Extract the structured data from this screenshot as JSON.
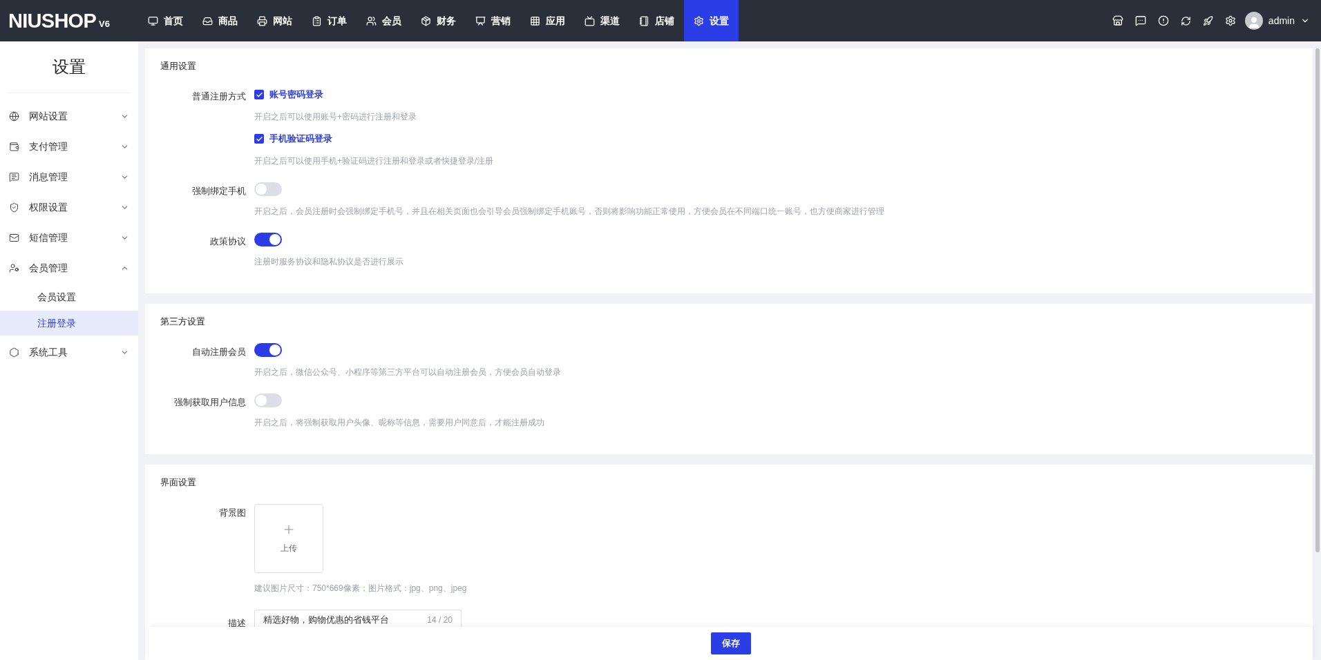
{
  "topbar": {
    "logo": "NIUSHOP",
    "version": "V6",
    "menu": [
      {
        "label": "首页",
        "selected": false
      },
      {
        "label": "商品",
        "selected": false
      },
      {
        "label": "网站",
        "selected": false
      },
      {
        "label": "订单",
        "selected": false
      },
      {
        "label": "会员",
        "selected": false
      },
      {
        "label": "财务",
        "selected": false
      },
      {
        "label": "营销",
        "selected": false
      },
      {
        "label": "应用",
        "selected": false
      },
      {
        "label": "渠道",
        "selected": false
      },
      {
        "label": "店铺",
        "selected": false
      },
      {
        "label": "设置",
        "selected": true
      }
    ],
    "user": "admin"
  },
  "sidebar": {
    "title": "设置",
    "items": [
      {
        "label": "网站设置",
        "expanded": false
      },
      {
        "label": "支付管理",
        "expanded": false
      },
      {
        "label": "消息管理",
        "expanded": false
      },
      {
        "label": "权限设置",
        "expanded": false
      },
      {
        "label": "短信管理",
        "expanded": false
      },
      {
        "label": "会员管理",
        "expanded": true,
        "children": [
          {
            "label": "会员设置",
            "selected": false
          },
          {
            "label": "注册登录",
            "selected": true
          }
        ]
      },
      {
        "label": "系统工具",
        "expanded": false
      }
    ]
  },
  "sections": [
    {
      "title": "通用设置",
      "rows": [
        {
          "kind": "checkboxes",
          "label": "普通注册方式",
          "options": [
            {
              "label": "账号密码登录",
              "checked": true,
              "hint": "开启之后可以使用账号+密码进行注册和登录"
            },
            {
              "label": "手机验证码登录",
              "checked": true,
              "hint": "开启之后可以使用手机+验证码进行注册和登录或者快捷登录/注册"
            }
          ]
        },
        {
          "kind": "switch",
          "label": "强制绑定手机",
          "on": false,
          "hint": "开启之后，会员注册时会强制绑定手机号，并且在相关页面也会引导会员强制绑定手机账号，否则将影响功能正常使用，方便会员在不同端口统一账号，也方便商家进行管理"
        },
        {
          "kind": "switch",
          "label": "政策协议",
          "on": true,
          "hint": "注册时服务协议和隐私协议是否进行展示"
        }
      ]
    },
    {
      "title": "第三方设置",
      "rows": [
        {
          "kind": "switch",
          "label": "自动注册会员",
          "on": true,
          "hint": "开启之后，微信公众号、小程序等第三方平台可以自动注册会员，方便会员自动登录"
        },
        {
          "kind": "switch",
          "label": "强制获取用户信息",
          "on": false,
          "hint": "开启之后，将强制获取用户头像、昵称等信息，需要用户同意后，才能注册成功"
        }
      ]
    },
    {
      "title": "界面设置",
      "rows": [
        {
          "kind": "upload",
          "label": "背景图",
          "button": "上传",
          "hint": "建议图片尺寸：750*669像素；图片格式：jpg、png、jpeg"
        },
        {
          "kind": "input",
          "label": "描述",
          "value": "精选好物，购物优惠的省钱平台",
          "counter": "14 / 20"
        }
      ]
    }
  ],
  "save_button": "保存"
}
